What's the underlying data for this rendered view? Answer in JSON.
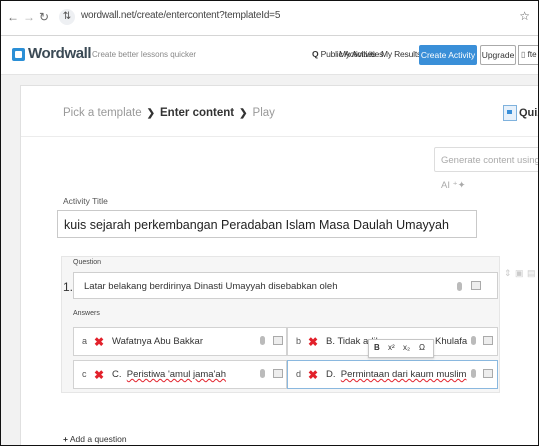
{
  "browser": {
    "url": "wordwall.net/create/entercontent?templateId=5"
  },
  "header": {
    "brand": "Wordwall",
    "tagline": "Create better lessons quicker",
    "nav": [
      "Public Activities",
      "My Activities",
      "My Results"
    ],
    "create_label": "Create Activity",
    "upgrade_label": "Upgrade",
    "user_short": "fte"
  },
  "steps": {
    "step1": "Pick a template",
    "step2": "Enter content",
    "step3": "Play",
    "template_label": "Quiz"
  },
  "generate_label": "Generate content using AI",
  "activity": {
    "label": "Activity Title",
    "title": "kuis sejarah perkembangan Peradaban Islam Masa Daulah Umayyah"
  },
  "question": {
    "label": "Question",
    "number": "1.",
    "text": "Latar belakang berdirinya Dinasti Umayyah disebabkan oleh"
  },
  "answers": {
    "label": "Answers",
    "items": [
      {
        "letter": "a",
        "text": "Wafatnya Abu Bakkar"
      },
      {
        "letter": "b",
        "text": "B.  Tidak adilnya",
        "tail": "Khulafa"
      },
      {
        "letter": "c",
        "prefix": "C.  ",
        "text": "Peristiwa 'amul jama'ah"
      },
      {
        "letter": "d",
        "prefix": "D.  ",
        "text": "Permintaan dari kaum muslim"
      }
    ]
  },
  "format_bar": {
    "bold": "B",
    "sup": "x²",
    "sub": "x₂",
    "omega": "Ω"
  },
  "add_question": "Add a question",
  "colors": {
    "accent": "#3a8fd8",
    "wrong": "#e2212b"
  }
}
